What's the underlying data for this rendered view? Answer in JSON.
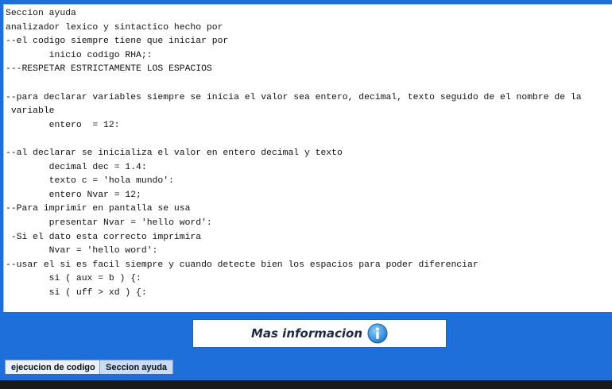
{
  "text_area": {
    "lines": [
      "Seccion ayuda",
      "analizador lexico y sintactico hecho por",
      "--el codigo siempre tiene que iniciar por",
      "        inicio codigo RHA;:",
      "---RESPETAR ESTRICTAMENTE LOS ESPACIOS",
      "",
      "--para declarar variables siempre se inicia el valor sea entero, decimal, texto seguido de el nombre de la",
      " variable",
      "        entero  = 12:",
      "",
      "--al declarar se inicializa el valor en entero decimal y texto",
      "        decimal dec = 1.4:",
      "        texto c = 'hola mundo':",
      "        entero Nvar = 12;",
      "--Para imprimir en pantalla se usa",
      "        presentar Nvar = 'hello word':",
      " -Si el dato esta correcto imprimira",
      "        Nvar = 'hello word':",
      "--usar el si es facil siempre y cuando detecte bien los espacios para poder diferenciar",
      "        si ( aux = b ) {:",
      "        si ( uff > xd ) {:"
    ]
  },
  "info_button": {
    "label": "Mas informacion",
    "icon": "info-icon",
    "icon_color": "#2f8fe0"
  },
  "tabs": [
    {
      "label": "ejecucion de codigo",
      "selected": true
    },
    {
      "label": "Seccion ayuda",
      "selected": false
    }
  ],
  "colors": {
    "panel_blue": "#1e6fd9",
    "text_bg": "#ffffff",
    "bottom_bar": "#1a1a1a"
  }
}
